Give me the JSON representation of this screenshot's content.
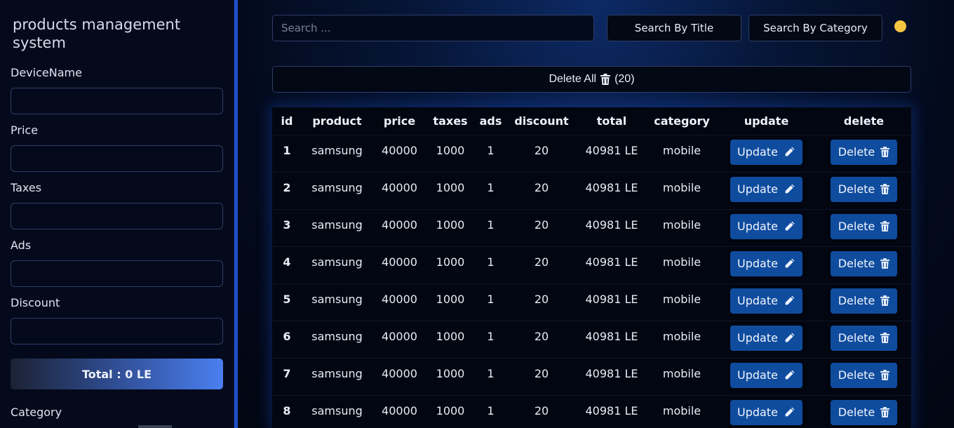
{
  "sidebar": {
    "title": "products management system",
    "fields": {
      "device_name": {
        "label": "DeviceName",
        "value": ""
      },
      "price": {
        "label": "Price",
        "value": ""
      },
      "taxes": {
        "label": "Taxes",
        "value": ""
      },
      "ads": {
        "label": "Ads",
        "value": ""
      },
      "discount": {
        "label": "Discount",
        "value": ""
      }
    },
    "total_label": "Total : 0 LE",
    "category_label": "Category"
  },
  "toolbar": {
    "search_placeholder": "Search ...",
    "search_by_title": "Search By Title",
    "search_by_category": "Search By Category",
    "status_color": "#f5c542"
  },
  "delete_all": {
    "label": "Delete All",
    "count": "(20)",
    "icon": "trash-icon"
  },
  "table": {
    "headers": [
      "id",
      "product",
      "price",
      "taxes",
      "ads",
      "discount",
      "total",
      "category",
      "update",
      "delete"
    ],
    "update_label": "Update",
    "delete_label": "Delete",
    "rows": [
      {
        "id": "1",
        "product": "samsung",
        "price": "40000",
        "taxes": "1000",
        "ads": "1",
        "discount": "20",
        "total": "40981 LE",
        "category": "mobile"
      },
      {
        "id": "2",
        "product": "samsung",
        "price": "40000",
        "taxes": "1000",
        "ads": "1",
        "discount": "20",
        "total": "40981 LE",
        "category": "mobile"
      },
      {
        "id": "3",
        "product": "samsung",
        "price": "40000",
        "taxes": "1000",
        "ads": "1",
        "discount": "20",
        "total": "40981 LE",
        "category": "mobile"
      },
      {
        "id": "4",
        "product": "samsung",
        "price": "40000",
        "taxes": "1000",
        "ads": "1",
        "discount": "20",
        "total": "40981 LE",
        "category": "mobile"
      },
      {
        "id": "5",
        "product": "samsung",
        "price": "40000",
        "taxes": "1000",
        "ads": "1",
        "discount": "20",
        "total": "40981 LE",
        "category": "mobile"
      },
      {
        "id": "6",
        "product": "samsung",
        "price": "40000",
        "taxes": "1000",
        "ads": "1",
        "discount": "20",
        "total": "40981 LE",
        "category": "mobile"
      },
      {
        "id": "7",
        "product": "samsung",
        "price": "40000",
        "taxes": "1000",
        "ads": "1",
        "discount": "20",
        "total": "40981 LE",
        "category": "mobile"
      },
      {
        "id": "8",
        "product": "samsung",
        "price": "40000",
        "taxes": "1000",
        "ads": "1",
        "discount": "20",
        "total": "40981 LE",
        "category": "mobile"
      }
    ]
  },
  "colors": {
    "accent": "#0f4c9e",
    "background": "#02040c",
    "sidebar": "#040a1b"
  }
}
